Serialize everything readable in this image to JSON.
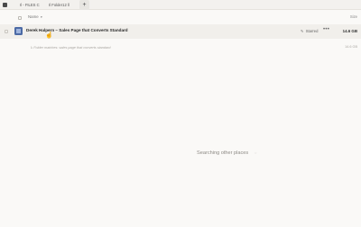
{
  "tabs": [
    {
      "label": "Il - FILES C"
    },
    {
      "label": "Il Folder12 ll"
    }
  ],
  "tab_add_label": "+",
  "header": {
    "name_label": "Name",
    "name_sort_caret": "▾",
    "size_label": "Size"
  },
  "row": {
    "name": "Derek Halpern – Sales Page that Converts Standard",
    "starred_label": "Starred",
    "starred_icon": "✎",
    "more_label": "•••",
    "size": "14.6 GB"
  },
  "subrow": {
    "name": "↳ Folder matches: sales page that converts standard",
    "size": "14.6 GB"
  },
  "status": {
    "text": "Searching other places",
    "spinner": "◌"
  },
  "icons": {
    "app": "app-icon",
    "file": "folder-icon",
    "cursor": "hand-pointer-icon"
  }
}
